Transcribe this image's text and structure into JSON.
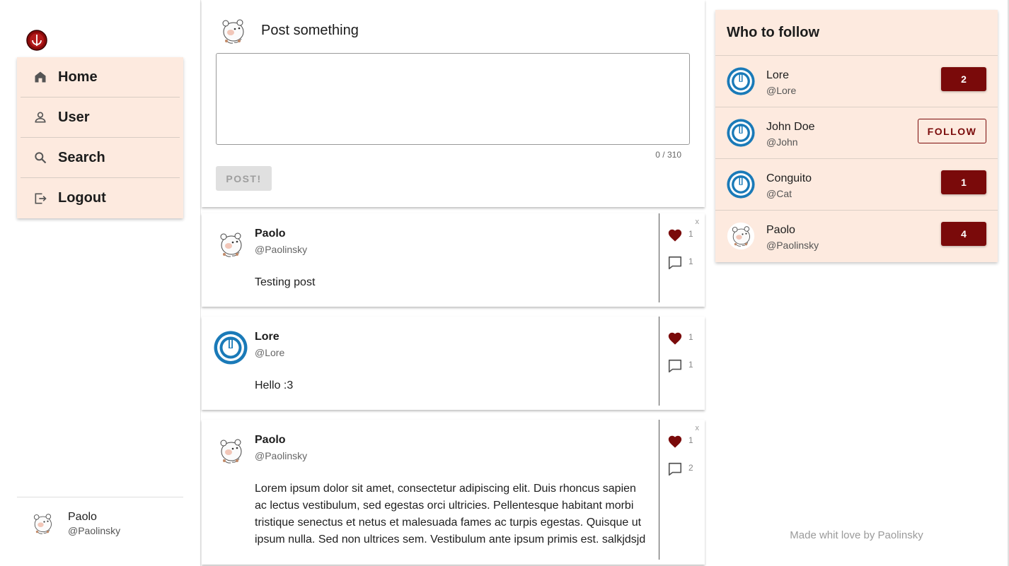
{
  "nav": {
    "items": [
      {
        "label": "Home",
        "icon": "home-icon"
      },
      {
        "label": "User",
        "icon": "person-icon"
      },
      {
        "label": "Search",
        "icon": "search-icon"
      },
      {
        "label": "Logout",
        "icon": "logout-icon"
      }
    ]
  },
  "current_user": {
    "name": "Paolo",
    "handle": "@Paolinsky"
  },
  "compose": {
    "title": "Post something",
    "counter": "0 / 310",
    "post_label": "POST!",
    "text": ""
  },
  "posts": [
    {
      "name": "Paolo",
      "handle": "@Paolinsky",
      "body": "Testing post",
      "likes": "1",
      "comments": "1",
      "delete_label": "x"
    },
    {
      "name": "Lore",
      "handle": "@Lore",
      "body": "Hello :3",
      "likes": "1",
      "comments": "1"
    },
    {
      "name": "Paolo",
      "handle": "@Paolinsky",
      "body": "Lorem ipsum dolor sit amet, consectetur adipiscing elit. Duis rhoncus sapien ac lectus vestibulum, sed egestas orci ultricies. Pellentesque habitant morbi tristique senectus et netus et malesuada fames ac turpis egestas. Quisque ut ipsum nulla. Sed non ultrices sem. Vestibulum ante ipsum primis est. salkjdsjd",
      "likes": "1",
      "comments": "2",
      "delete_label": "x"
    }
  ],
  "who_to_follow": {
    "title": "Who to follow",
    "users": [
      {
        "name": "Lore",
        "handle": "@Lore",
        "button": "2"
      },
      {
        "name": "John Doe",
        "handle": "@John",
        "button": "FOLLOW"
      },
      {
        "name": "Conguito",
        "handle": "@Cat",
        "button": "1"
      },
      {
        "name": "Paolo",
        "handle": "@Paolinsky",
        "button": "4"
      }
    ]
  },
  "footer": {
    "credit": "Made whit love by Paolinsky"
  },
  "colors": {
    "accent": "#7a0a0a",
    "panel": "#fdeadf",
    "like": "#7a0a0a",
    "blue_avatar": "#1a7ab8"
  }
}
